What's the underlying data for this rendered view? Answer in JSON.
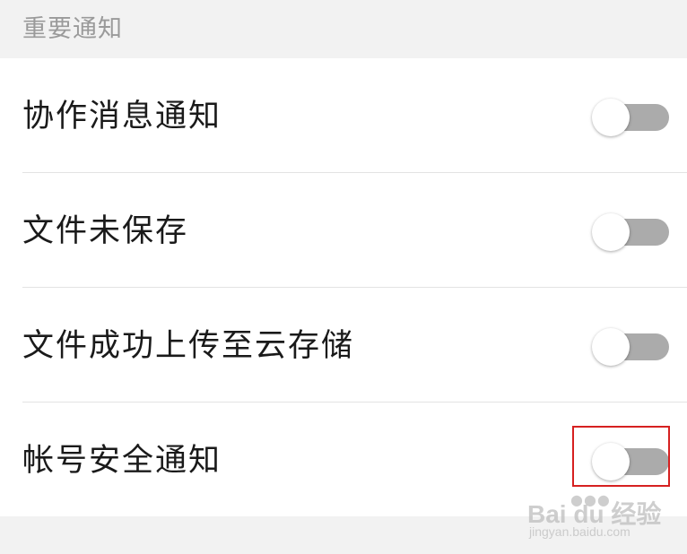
{
  "section": {
    "title": "重要通知"
  },
  "settings": [
    {
      "label": "协作消息通知",
      "enabled": false
    },
    {
      "label": "文件未保存",
      "enabled": false
    },
    {
      "label": "文件成功上传至云存储",
      "enabled": false
    },
    {
      "label": "帐号安全通知",
      "enabled": false
    }
  ],
  "colors": {
    "toggle_off_track": "#ababab",
    "toggle_knob": "#ffffff",
    "highlight": "#d62020",
    "section_bg": "#f2f2f2",
    "list_bg": "#ffffff"
  },
  "watermark": {
    "main": "Bai du 经验",
    "sub": "jingyan.baidu.com"
  }
}
